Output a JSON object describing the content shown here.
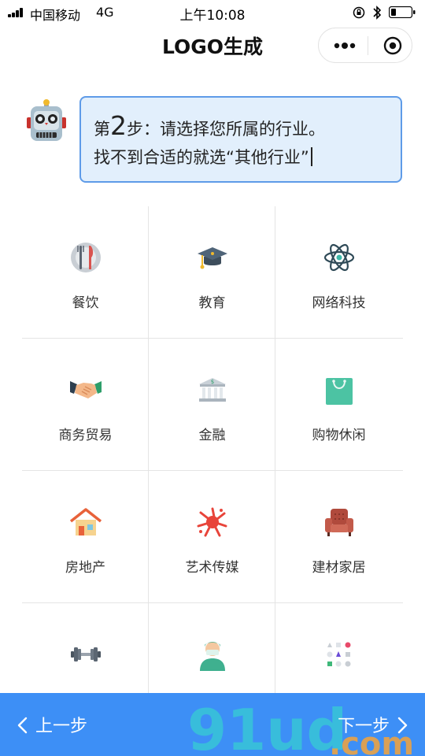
{
  "status_bar": {
    "carrier": "中国移动",
    "network": "4G",
    "time": "上午10:08"
  },
  "nav": {
    "title": "LOGO生成"
  },
  "prompt": {
    "prefix": "第",
    "step": "2",
    "line1_rest": "步：请选择您所属的行业。",
    "line2": "找不到合适的就选“其他行业”"
  },
  "industries": [
    {
      "label": "餐饮",
      "icon": "plate-utensils-icon"
    },
    {
      "label": "教育",
      "icon": "graduation-cap-icon"
    },
    {
      "label": "网络科技",
      "icon": "atom-icon"
    },
    {
      "label": "商务贸易",
      "icon": "handshake-icon"
    },
    {
      "label": "金融",
      "icon": "bank-icon"
    },
    {
      "label": "购物休闲",
      "icon": "shopping-bag-icon"
    },
    {
      "label": "房地产",
      "icon": "house-icon"
    },
    {
      "label": "艺术传媒",
      "icon": "paint-splash-icon"
    },
    {
      "label": "建材家居",
      "icon": "armchair-icon"
    },
    {
      "label": "",
      "icon": "dumbbell-icon"
    },
    {
      "label": "",
      "icon": "doctor-icon"
    },
    {
      "label": "",
      "icon": "shapes-icon"
    }
  ],
  "footer": {
    "prev_label": "上一步",
    "next_label": "下一步"
  },
  "colors": {
    "accent": "#3d8ff6",
    "bubble_bg": "#e2effc",
    "bubble_border": "#5e9be8"
  }
}
